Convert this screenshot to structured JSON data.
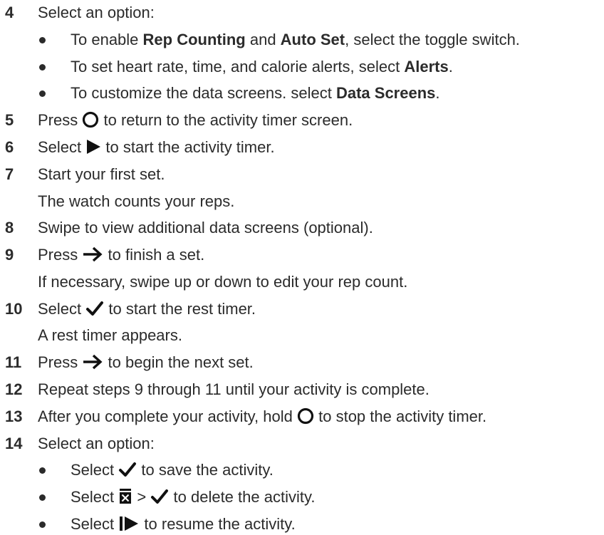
{
  "steps": {
    "s4": {
      "num": "4",
      "text": "Select an option:"
    },
    "s4_bullets": [
      {
        "pre": "To enable ",
        "b1": "Rep Counting",
        "mid": " and ",
        "b2": "Auto Set",
        "post": ", select the toggle switch."
      },
      {
        "pre": "To set heart rate, time, and calorie alerts, select ",
        "b1": "Alerts",
        "post": "."
      },
      {
        "pre": "To customize the data screens. select ",
        "b1": "Data Screens",
        "post": "."
      }
    ],
    "s5": {
      "num": "5",
      "pre": "Press",
      "icon": "circle-button-icon",
      "post": "to return to the activity timer screen."
    },
    "s6": {
      "num": "6",
      "pre": "Select",
      "icon": "play-icon",
      "post": "to start the activity timer."
    },
    "s7": {
      "num": "7",
      "text": "Start your first set.",
      "cont": "The watch counts your reps."
    },
    "s8": {
      "num": "8",
      "text": "Swipe to view additional data screens (optional)."
    },
    "s9": {
      "num": "9",
      "pre": "Press",
      "icon": "right-arrow-icon",
      "post": "to finish a set.",
      "cont": "If necessary, swipe up or down to edit your rep count."
    },
    "s10": {
      "num": "10",
      "pre": "Select",
      "icon": "checkmark-icon",
      "post": "to start the rest timer.",
      "cont": "A rest timer appears."
    },
    "s11": {
      "num": "11",
      "pre": "Press",
      "icon": "right-arrow-icon",
      "post": "to begin the next set."
    },
    "s12": {
      "num": "12",
      "text": "Repeat steps 9 through 11 until your activity is complete."
    },
    "s13": {
      "num": "13",
      "pre": "After you complete your activity, hold",
      "icon": "circle-button-icon",
      "post": "to stop the activity timer."
    },
    "s14": {
      "num": "14",
      "text": "Select an option:"
    },
    "s14_bullets": [
      {
        "pre": "Select",
        "icon": "checkmark-icon",
        "post": "to save the activity."
      },
      {
        "pre": "Select",
        "icon": "trash-icon",
        "sep": ">",
        "icon2": "checkmark-icon",
        "post": "to delete the activity."
      },
      {
        "pre": "Select",
        "icon": "resume-icon",
        "post": "to resume the activity."
      }
    ]
  },
  "colors": {
    "text": "#2b2b2b",
    "icon": "#111111"
  }
}
